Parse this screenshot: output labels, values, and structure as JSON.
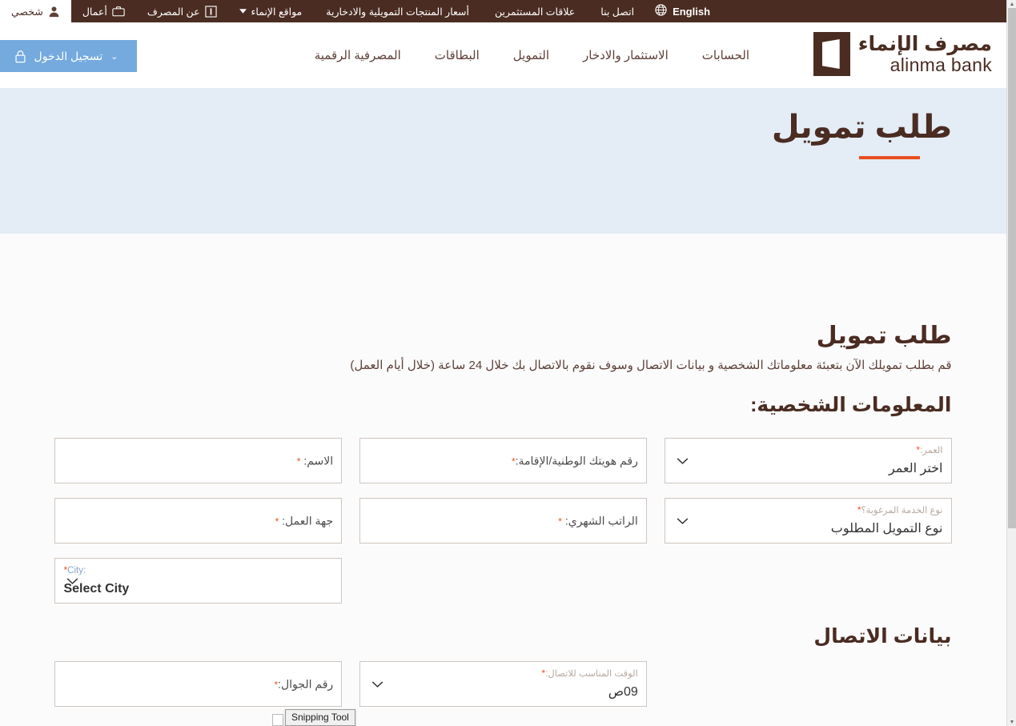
{
  "utility_bar": {
    "language_label": "English",
    "language_icon": "globe-icon",
    "links": [
      {
        "label": "أسعار المنتجات التمويلية والادخارية"
      },
      {
        "label": "علاقات المستثمرين"
      },
      {
        "label": "اتصل بنا"
      }
    ],
    "tabs": [
      {
        "label": "شخصي",
        "icon": "person-icon",
        "active": true
      },
      {
        "label": "أعمال",
        "icon": "briefcase-icon",
        "active": false
      },
      {
        "label": "عن المصرف",
        "icon": "info-icon",
        "active": false
      },
      {
        "label": "مواقع الإنماء",
        "icon": "chevron-down-icon",
        "active": false
      }
    ]
  },
  "header": {
    "logo_arabic": "مصرف الإنماء",
    "logo_english": "alinma bank",
    "nav_items": [
      {
        "label": "الحسابات"
      },
      {
        "label": "الاستثمار والادخار"
      },
      {
        "label": "التمويل"
      },
      {
        "label": "البطاقات"
      },
      {
        "label": "المصرفية الرقمية"
      }
    ],
    "login_label": "تسجيل الدخول",
    "login_icon": "lock-icon",
    "login_chevron": "⌄"
  },
  "hero": {
    "title": "طلب تمويل"
  },
  "main": {
    "title": "طلب تمويل",
    "subtitle": "قم بطلب تمويلك الآن بتعبئة معلوماتك الشخصية و بيانات الاتصال وسوف نقوم بالاتصال بك خلال 24 ساعة (خلال أيام العمل)",
    "personal_section_title": "المعلومات الشخصية:",
    "contact_section_title": "بيانات الاتصال",
    "required_mark": "*",
    "fields": {
      "name": {
        "label": "الاسم:",
        "value": "",
        "type": "input"
      },
      "national_id": {
        "label": "رقم هويتك الوطنية/الإقامة:",
        "value": "",
        "type": "input"
      },
      "age": {
        "label": "العمر:",
        "value": "اختر العمر",
        "type": "select"
      },
      "employer": {
        "label": "جهة العمل:",
        "value": "",
        "type": "input"
      },
      "monthly_salary": {
        "label": "الراتب الشهري:",
        "value": "",
        "type": "input"
      },
      "service_type": {
        "label": "نوع الخدمة المرغوبة؟",
        "value": "نوع التمويل المطلوب",
        "type": "select"
      },
      "city": {
        "label": "City:",
        "value": "Select City",
        "type": "select"
      },
      "mobile": {
        "label": "رقم الجوال:",
        "value": "",
        "type": "input"
      },
      "contact_time": {
        "label": "الوقت المناسب للاتصال:",
        "value": "09ص",
        "type": "select"
      }
    }
  },
  "overlay": {
    "snipping_tool_tooltip": "Snipping Tool"
  },
  "colors": {
    "brand_brown": "#4a2c22",
    "accent_orange": "#e8501e",
    "hero_blue": "#e4ecf6",
    "login_blue": "#74aade",
    "field_border": "#cfc5bd"
  }
}
